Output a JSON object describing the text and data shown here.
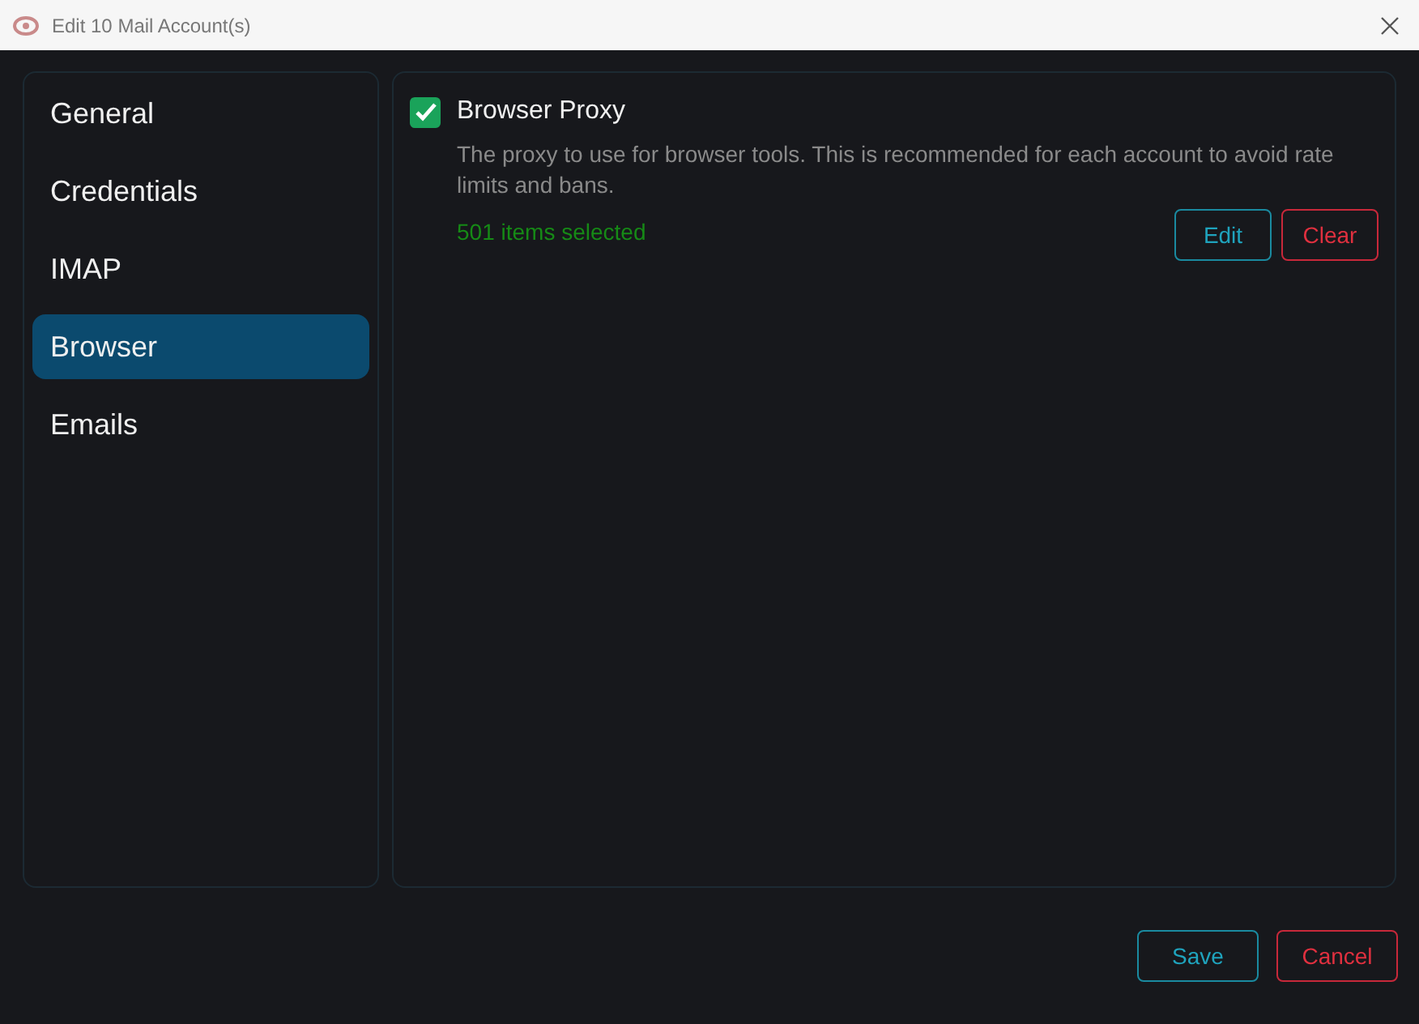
{
  "window": {
    "title": "Edit 10 Mail Account(s)"
  },
  "sidebar": {
    "items": [
      {
        "label": "General",
        "selected": false
      },
      {
        "label": "Credentials",
        "selected": false
      },
      {
        "label": "IMAP",
        "selected": false
      },
      {
        "label": "Browser",
        "selected": true
      },
      {
        "label": "Emails",
        "selected": false
      }
    ]
  },
  "setting": {
    "label": "Browser Proxy",
    "checked": true,
    "description": "The proxy to use for browser tools. This is recommended for each account to avoid rate limits and bans.",
    "status": "501 items selected",
    "buttons": [
      {
        "label": "Edit",
        "kind": "primary"
      },
      {
        "label": "Clear",
        "kind": "danger"
      }
    ]
  },
  "footer": {
    "buttons": [
      {
        "label": "Save",
        "kind": "primary"
      },
      {
        "label": "Cancel",
        "kind": "danger"
      }
    ]
  }
}
